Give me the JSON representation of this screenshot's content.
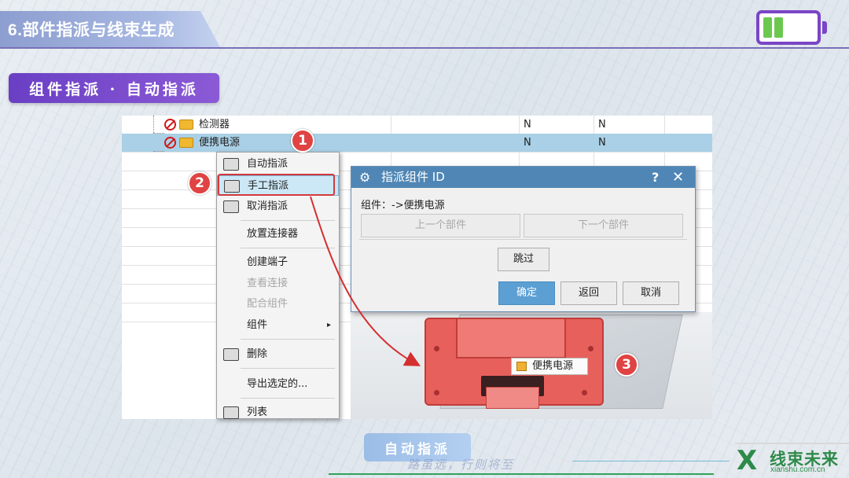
{
  "header": {
    "title": "6.部件指派与线束生成"
  },
  "section": {
    "label": "组件指派 · 自动指派"
  },
  "tree": {
    "rows": [
      {
        "label": "检测器",
        "col2": "N",
        "col3": "N"
      },
      {
        "label": "便携电源",
        "col2": "N",
        "col3": "N"
      }
    ]
  },
  "context_menu": {
    "items": [
      {
        "label": "自动指派",
        "state": "enabled"
      },
      {
        "label": "手工指派",
        "state": "highlighted"
      },
      {
        "label": "取消指派",
        "state": "enabled"
      },
      {
        "label": "放置连接器",
        "state": "enabled"
      },
      {
        "label": "创建端子",
        "state": "enabled"
      },
      {
        "label": "查看连接",
        "state": "disabled"
      },
      {
        "label": "配合组件",
        "state": "disabled"
      },
      {
        "label": "组件",
        "state": "enabled"
      },
      {
        "label": "删除",
        "state": "enabled"
      },
      {
        "label": "导出选定的...",
        "state": "enabled"
      },
      {
        "label": "列表",
        "state": "enabled"
      }
    ],
    "submenu_arrow": "▸"
  },
  "dialog": {
    "title": "指派组件 ID",
    "help": "?",
    "close": "✕",
    "component_text": "组件：->便携电源",
    "prev_label": "上一个部件",
    "next_label": "下一个部件",
    "skip_label": "跳过",
    "ok_label": "确定",
    "back_label": "返回",
    "cancel_label": "取消"
  },
  "model": {
    "tooltip": "便携电源"
  },
  "steps": [
    "1",
    "2",
    "3"
  ],
  "footer": {
    "badge": "自动指派",
    "slogan": "路虽远，行则将至",
    "logo_text": "线束未来",
    "logo_url": "xianshu.com.cn"
  },
  "colors": {
    "accent_purple": "#7a45c6",
    "step_red": "#e04343",
    "dialog_blue": "#4f86b5",
    "logo_green": "#2e8a49"
  }
}
